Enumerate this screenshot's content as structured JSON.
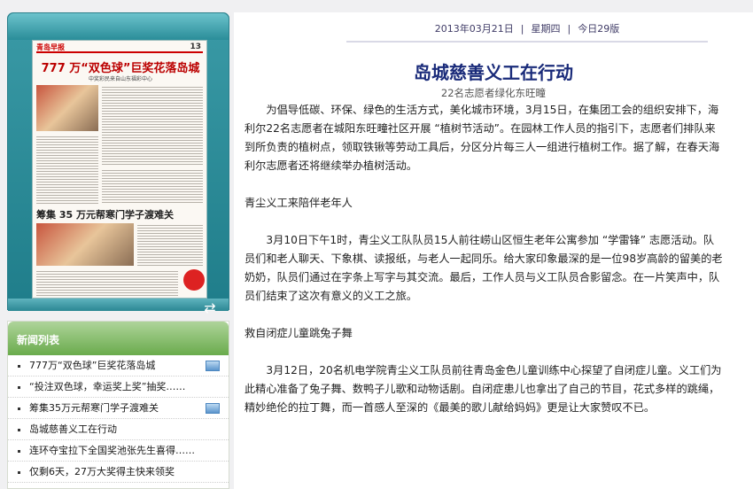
{
  "newspaper": {
    "masthead": "青岛早报",
    "page_num": "13",
    "headline": "777 万“双色球”巨奖花落岛城",
    "subhead": "中奖彩民来自山东福彩中心",
    "headline2": "筹集 35 万元帮寒门学子渡难关"
  },
  "news_list": {
    "title": "新闻列表",
    "items": [
      {
        "label": "777万“双色球”巨奖花落岛城",
        "has_pic": true
      },
      {
        "label": "“投注双色球，幸运奖上奖”抽奖……",
        "has_pic": false
      },
      {
        "label": "筹集35万元帮寒门学子渡难关",
        "has_pic": true
      },
      {
        "label": "岛城慈善义工在行动",
        "has_pic": false
      },
      {
        "label": "连环夺宝拉下全国奖池张先生喜得……",
        "has_pic": false
      },
      {
        "label": "仅剩6天，27万大奖得主快来领奖",
        "has_pic": false
      }
    ]
  },
  "date_bar": {
    "date": "2013年03月21日",
    "weekday": "星期四",
    "edition": "今日29版"
  },
  "article": {
    "title": "岛城慈善义工在行动",
    "subtitle": "22名志愿者绿化东旺疃",
    "paragraphs": [
      {
        "text": "为倡导低碳、环保、绿色的生活方式，美化城市环境，3月15日，在集团工会的组织安排下，海利尔22名志愿者在城阳东旺疃社区开展 “植树节活动”。在园林工作人员的指引下，志愿者们排队来到所负责的植树点，领取铁锹等劳动工具后，分区分片每三人一组进行植树工作。据了解，在春天海利尔志愿者还将继续举办植树活动。",
        "indent": true
      },
      {
        "text": "青尘义工来陪伴老年人",
        "indent": false
      },
      {
        "text": "3月10日下午1时，青尘义工队队员15人前往崂山区恒生老年公寓参加 “学雷锋” 志愿活动。队员们和老人聊天、下象棋、读报纸，与老人一起同乐。给大家印象最深的是一位98岁高龄的留美的老奶奶，队员们通过在字条上写字与其交流。最后，工作人员与义工队员合影留念。在一片笑声中，队员们结束了这次有意义的义工之旅。",
        "indent": true
      },
      {
        "text": "救自闭症儿童跳兔子舞",
        "indent": false
      },
      {
        "text": "3月12日，20名机电学院青尘义工队员前往青岛金色儿童训练中心探望了自闭症儿童。义工们为此精心准备了兔子舞、数鸭子儿歌和动物话剧。自闭症患儿也拿出了自己的节目，花式多样的跳绳，精妙绝伦的拉丁舞，而一首感人至深的《最美的歌儿献给妈妈》更是让大家赞叹不已。",
        "indent": true
      }
    ]
  }
}
